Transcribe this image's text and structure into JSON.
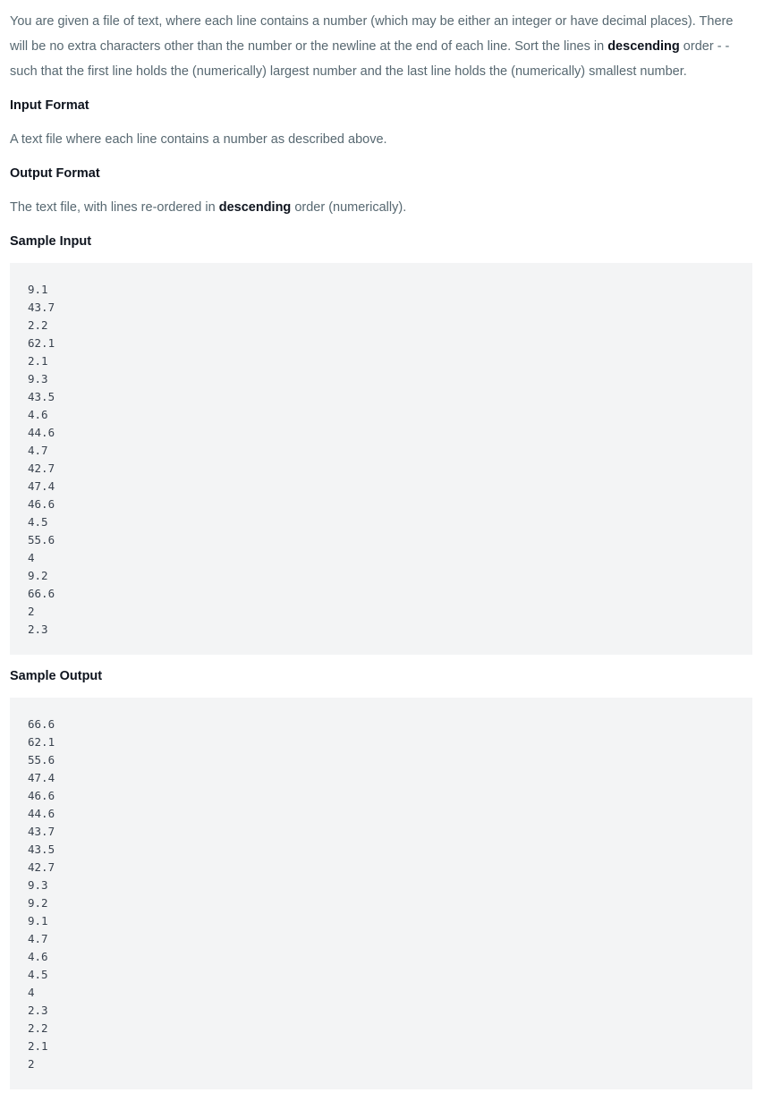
{
  "intro": {
    "part1": "You are given a file of text, where each line contains a number (which may be either an integer or have decimal places). There will be no extra characters other than the number or the newline at the end of each line. Sort the lines in ",
    "emph": "descending",
    "part2": " order - - such that the first line holds the (numerically) largest number and the last line holds the (numerically) smallest number."
  },
  "input_format": {
    "heading": "Input Format",
    "text": "A text file where each line contains a number as described above."
  },
  "output_format": {
    "heading": "Output Format",
    "part1": "The text file, with lines re-ordered in ",
    "emph": "descending",
    "part2": " order (numerically)."
  },
  "sample_input": {
    "heading": "Sample Input",
    "lines": [
      "9.1",
      "43.7",
      "2.2",
      "62.1",
      "2.1",
      "9.3",
      "43.5",
      "4.6",
      "44.6",
      "4.7",
      "42.7",
      "47.4",
      "46.6",
      "4.5",
      "55.6",
      "4",
      "9.2",
      "66.6",
      "2",
      "2.3"
    ]
  },
  "sample_output": {
    "heading": "Sample Output",
    "lines": [
      "66.6",
      "62.1",
      "55.6",
      "47.4",
      "46.6",
      "44.6",
      "43.7",
      "43.5",
      "42.7",
      "9.3",
      "9.2",
      "9.1",
      "4.7",
      "4.6",
      "4.5",
      "4",
      "2.3",
      "2.2",
      "2.1",
      "2"
    ]
  }
}
